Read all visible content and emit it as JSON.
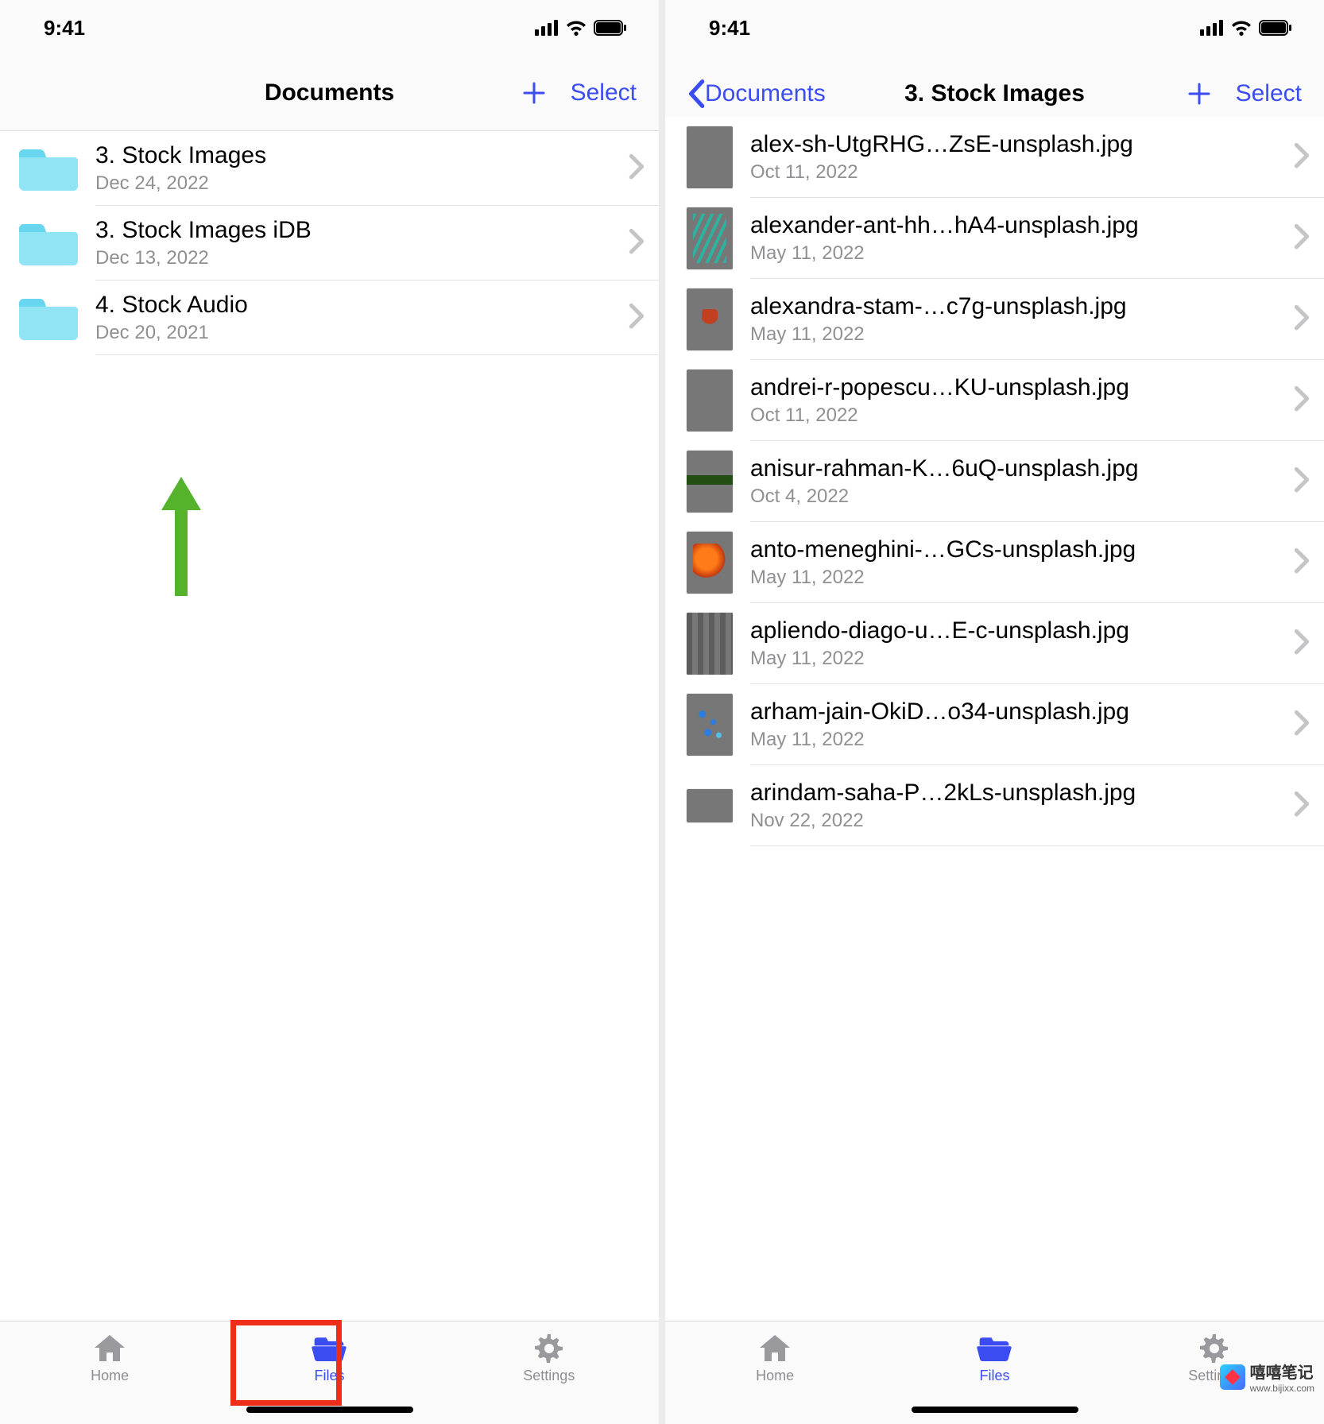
{
  "status": {
    "time": "9:41"
  },
  "left_screen": {
    "title": "Documents",
    "select_label": "Select",
    "folders": [
      {
        "name": "3. Stock Images",
        "date": "Dec 24, 2022"
      },
      {
        "name": "3. Stock Images iDB",
        "date": "Dec 13, 2022"
      },
      {
        "name": "4. Stock Audio",
        "date": "Dec 20, 2021"
      }
    ]
  },
  "right_screen": {
    "back_label": "Documents",
    "title": "3. Stock Images",
    "select_label": "Select",
    "files": [
      {
        "name": "alex-sh-UtgRHG…ZsE-unsplash.jpg",
        "date": "Oct 11, 2022"
      },
      {
        "name": "alexander-ant-hh…hA4-unsplash.jpg",
        "date": "May 11, 2022"
      },
      {
        "name": "alexandra-stam-…c7g-unsplash.jpg",
        "date": "May 11, 2022"
      },
      {
        "name": "andrei-r-popescu…KU-unsplash.jpg",
        "date": "Oct 11, 2022"
      },
      {
        "name": "anisur-rahman-K…6uQ-unsplash.jpg",
        "date": "Oct 4, 2022"
      },
      {
        "name": "anto-meneghini-…GCs-unsplash.jpg",
        "date": "May 11, 2022"
      },
      {
        "name": "apliendo-diago-u…E-c-unsplash.jpg",
        "date": "May 11, 2022"
      },
      {
        "name": "arham-jain-OkiD…o34-unsplash.jpg",
        "date": "May 11, 2022"
      },
      {
        "name": "arindam-saha-P…2kLs-unsplash.jpg",
        "date": "Nov 22, 2022"
      }
    ]
  },
  "tabs": {
    "home": "Home",
    "files": "Files",
    "settings": "Settings"
  },
  "watermark": {
    "text": "嘻嘻笔记",
    "url": "www.bijixx.com"
  }
}
